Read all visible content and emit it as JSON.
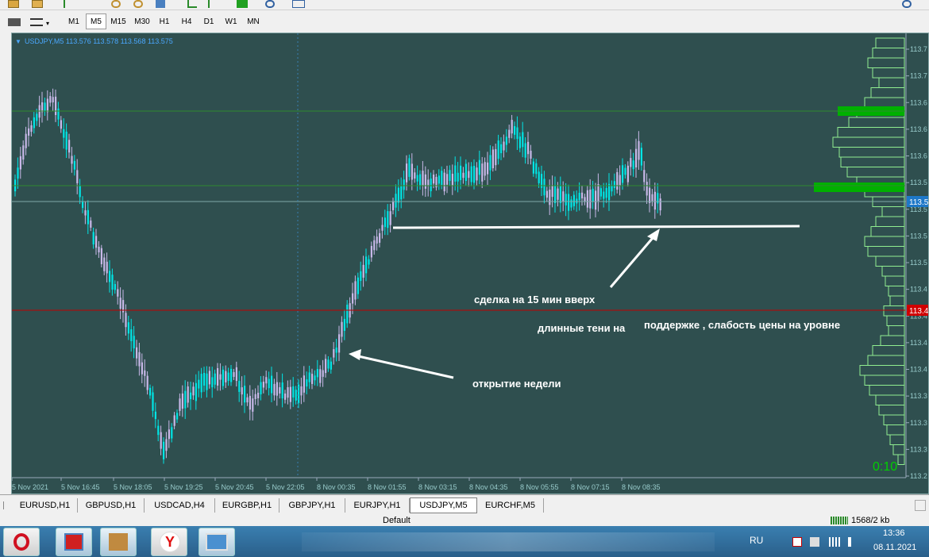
{
  "toolbar": {
    "timeframes": [
      "M1",
      "M5",
      "M15",
      "M30",
      "H1",
      "H4",
      "D1",
      "W1",
      "MN"
    ],
    "active_timeframe": "M5"
  },
  "chart": {
    "symbol_line": "USDJPY,M5  113.576 113.578 113.568 113.575",
    "timer": "0:10",
    "current_price_label": "113.5",
    "red_line_label": "113.4",
    "price_ticks": [
      "113.7",
      "113.7",
      "113.6",
      "113.6",
      "113.6",
      "113.5",
      "113.5",
      "113.5",
      "113.5",
      "113.4",
      "113.4",
      "113.4",
      "113.4",
      "113.3",
      "113.3",
      "113.3",
      "113.2"
    ],
    "time_ticks": [
      "5 Nov 2021",
      "5 Nov 16:45",
      "5 Nov 18:05",
      "5 Nov 19:25",
      "5 Nov 20:45",
      "5 Nov 22:05",
      "8 Nov 00:35",
      "8 Nov 01:55",
      "8 Nov 03:15",
      "8 Nov 04:35",
      "8 Nov 05:55",
      "8 Nov 07:15",
      "8 Nov 08:35"
    ],
    "annotations": {
      "trade": "сделка на 15 мин вверх",
      "shadows_a": "длинные тени на",
      "shadows_b": "поддержке , слабость цены на уровне",
      "open_week": "открытие недели"
    },
    "colors": {
      "background": "#2f4f4f",
      "bull": "#00e5e5",
      "bear": "#c8b8e8",
      "volume": "#00b000",
      "red_line": "#c00000",
      "white_annotation": "#ffffff"
    }
  },
  "tabs": [
    "EURUSD,H1",
    "GBPUSD,H1",
    "USDCAD,H4",
    "EURGBP,H1",
    "GBPJPY,H1",
    "EURJPY,H1",
    "USDJPY,M5",
    "EURCHF,M5"
  ],
  "active_tab": "USDJPY,M5",
  "status": {
    "profile": "Default",
    "traffic": "1568/2 kb"
  },
  "taskbar": {
    "lang": "RU",
    "time": "13:36",
    "date": "08.11.2021"
  }
}
